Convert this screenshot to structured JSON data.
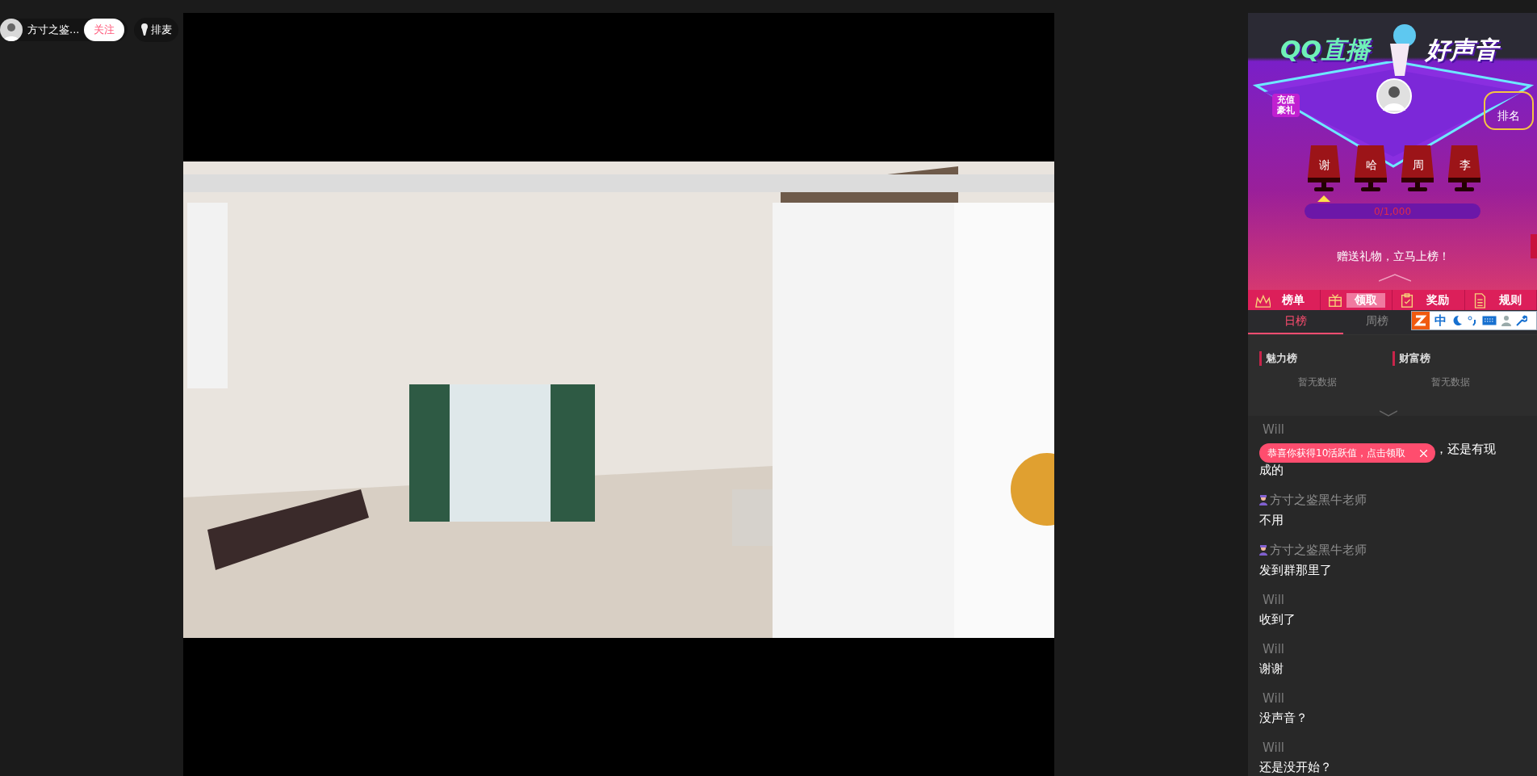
{
  "streamer": {
    "name": "方寸之鉴...",
    "follow_label": "关注",
    "queue_label": "排麦"
  },
  "banner": {
    "logo": "QQ直播",
    "logo_2": "好声音",
    "gift_label": "充值豪礼",
    "rank_label": "排名",
    "progress": "0/1,000",
    "level": 0,
    "prompt": "赠送礼物，立马上榜！",
    "seats": [
      {
        "label": "谢",
        "selected": true
      },
      {
        "label": "哈",
        "selected": false
      },
      {
        "label": "周",
        "selected": false
      },
      {
        "label": "李",
        "selected": false
      }
    ]
  },
  "action_tabs": [
    {
      "label": "榜单",
      "selected": false
    },
    {
      "label": "领取",
      "selected": true
    },
    {
      "label": "奖励",
      "selected": false
    },
    {
      "label": "规则",
      "selected": false
    }
  ],
  "rank_tabs": [
    {
      "label": "日榜",
      "selected": true
    },
    {
      "label": "周榜",
      "selected": false
    }
  ],
  "ime_bar": {
    "mode": "中"
  },
  "boards": [
    {
      "title": "魅力榜",
      "empty": "暂无数据"
    },
    {
      "title": "财富榜",
      "empty": "暂无数据"
    }
  ],
  "chat": [
    {
      "user": "Will",
      "host": false,
      "text": "，还是有现",
      "text_2": "成的"
    },
    {
      "user": "方寸之鉴黑牛老师",
      "host": true,
      "text": "不用"
    },
    {
      "user": "方寸之鉴黑牛老师",
      "host": true,
      "text": "发到群那里了"
    },
    {
      "user": "Will",
      "host": false,
      "text": "收到了"
    },
    {
      "user": "Will",
      "host": false,
      "text": "谢谢"
    },
    {
      "user": "Will",
      "host": false,
      "text": "没声音？"
    },
    {
      "user": "Will",
      "host": false,
      "text": "还是没开始？"
    }
  ],
  "toast": {
    "text": "恭喜你获得10活跃值，点击领取"
  }
}
